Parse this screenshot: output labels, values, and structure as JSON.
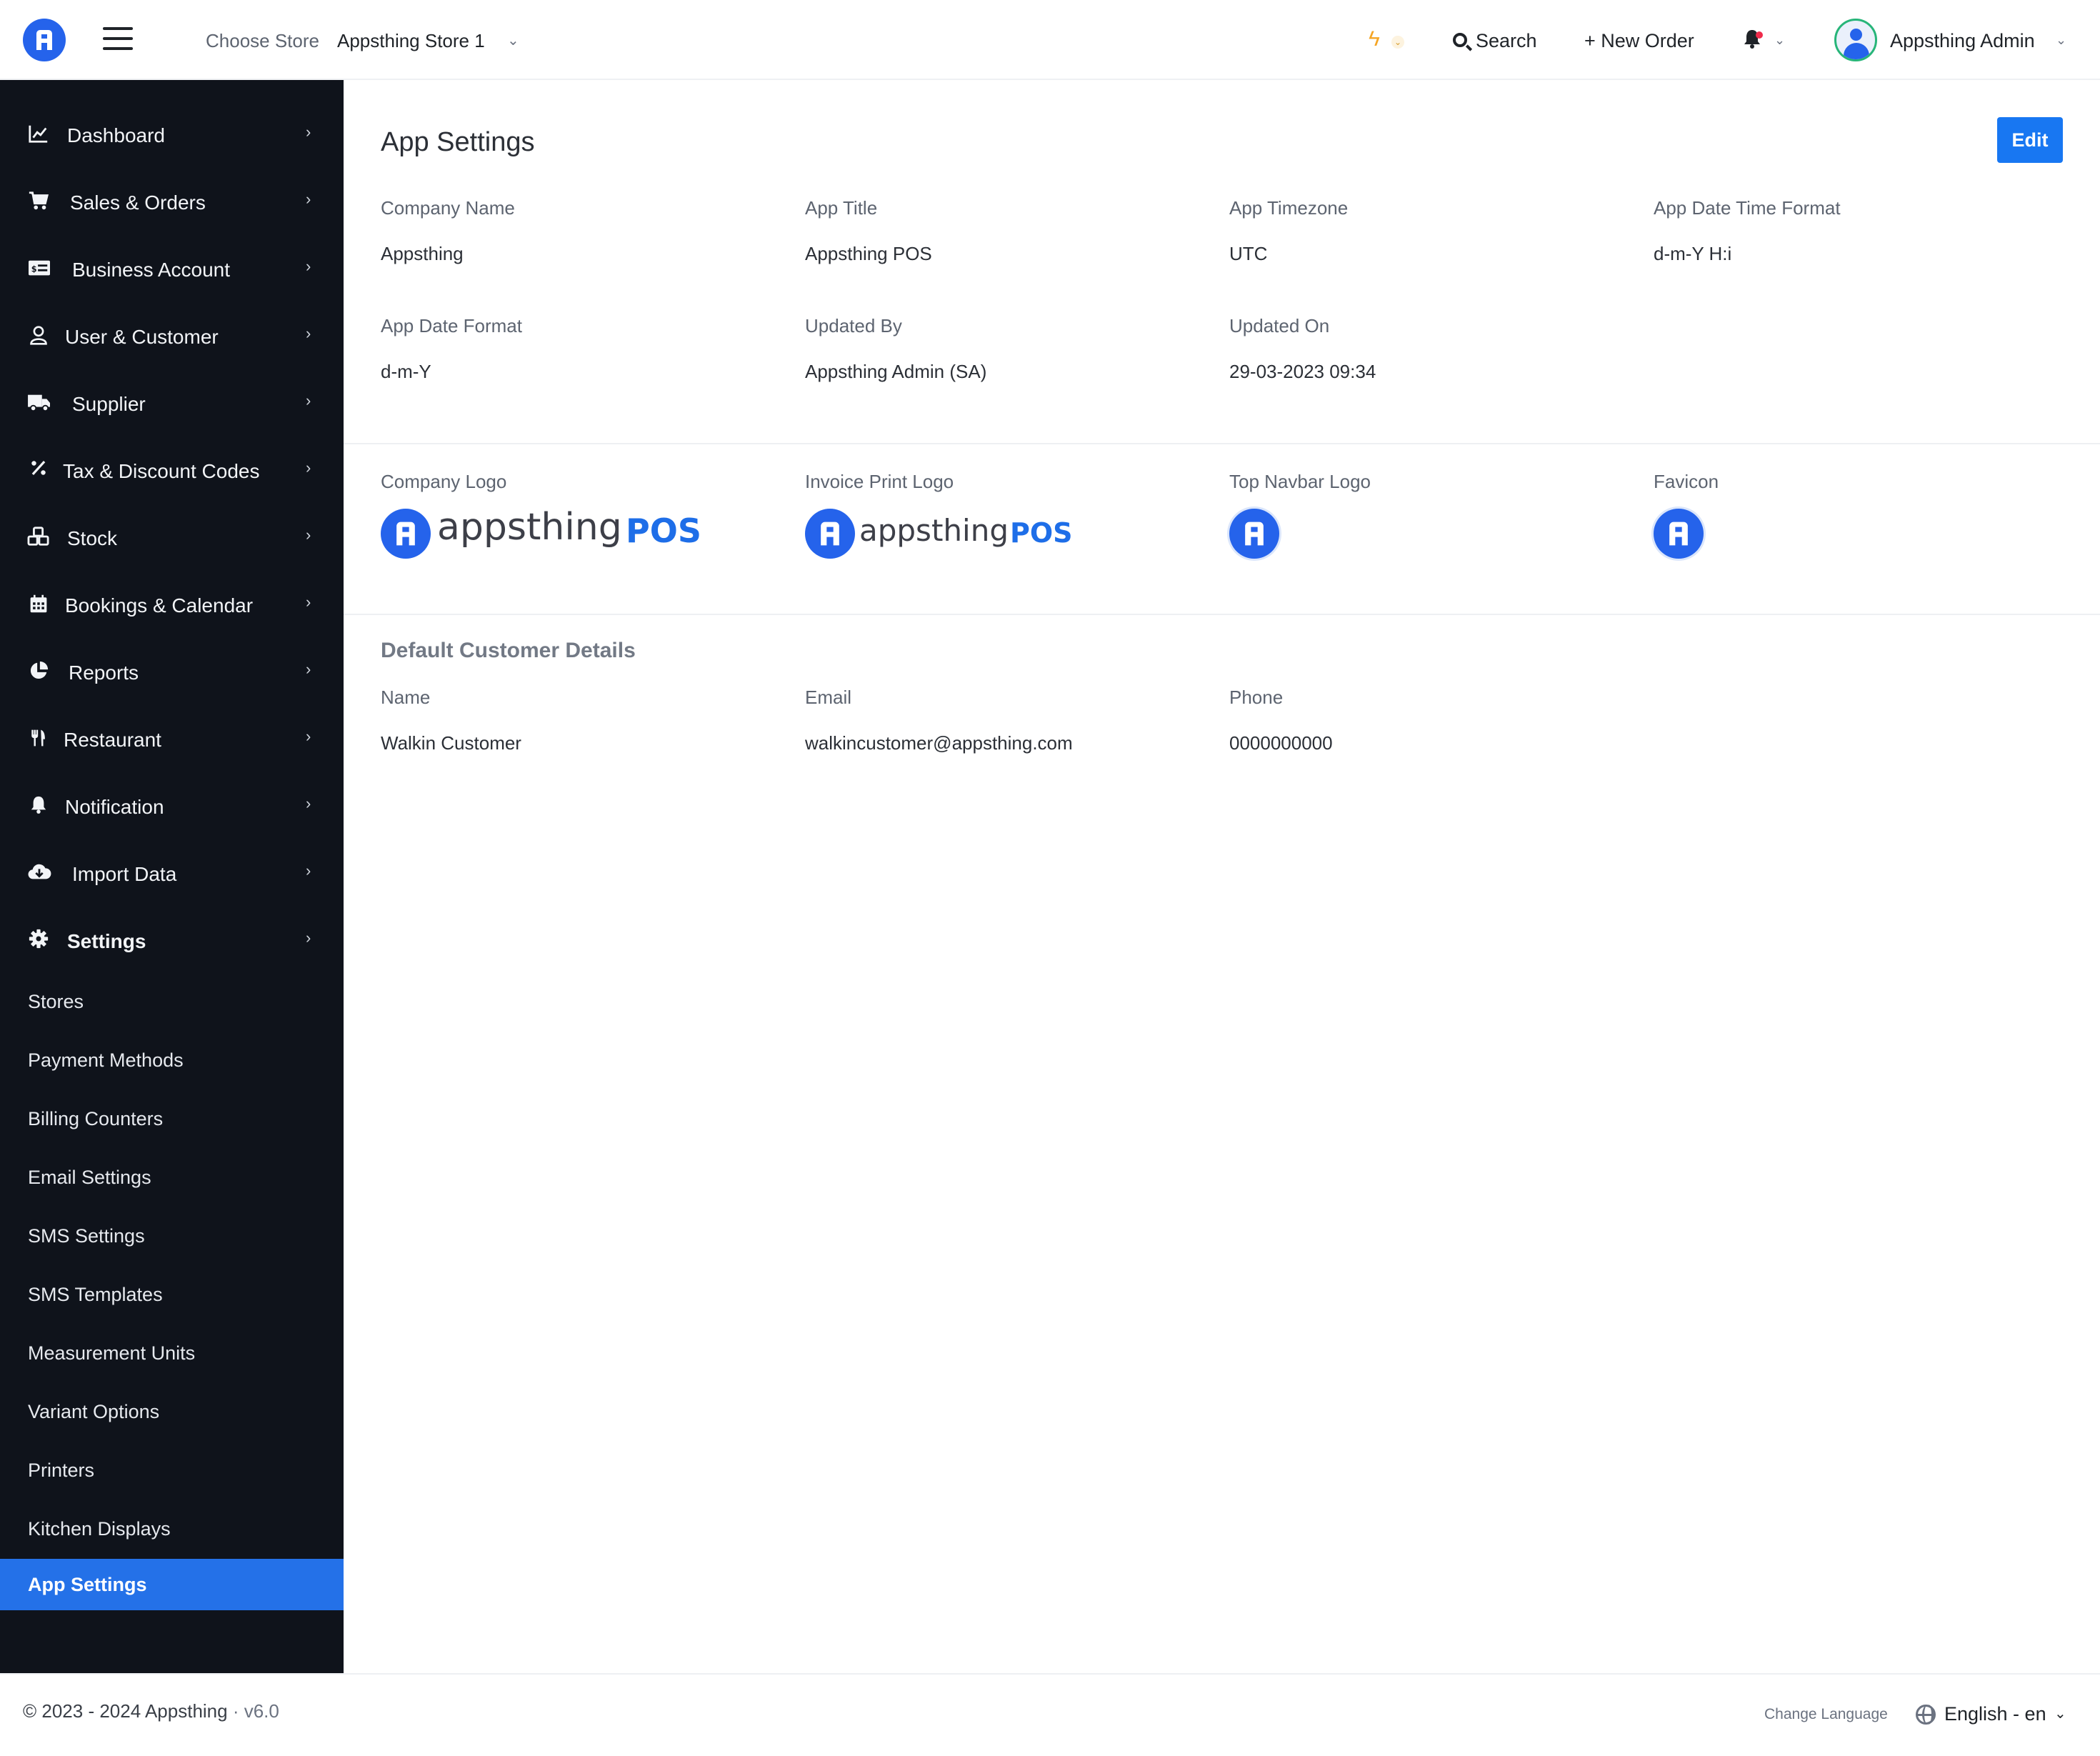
{
  "header": {
    "store_label": "Choose Store",
    "store_value": "Appsthing Store 1",
    "search_label": "Search",
    "new_order_label": "+ New Order",
    "admin_name": "Appsthing Admin"
  },
  "sidebar": {
    "items": [
      {
        "label": "Dashboard",
        "icon": "chart-line-icon"
      },
      {
        "label": "Sales & Orders",
        "icon": "cart-icon"
      },
      {
        "label": "Business Account",
        "icon": "money-card-icon"
      },
      {
        "label": "User & Customer",
        "icon": "user-icon"
      },
      {
        "label": "Supplier",
        "icon": "truck-icon"
      },
      {
        "label": "Tax & Discount Codes",
        "icon": "percent-icon"
      },
      {
        "label": "Stock",
        "icon": "boxes-icon"
      },
      {
        "label": "Bookings & Calendar",
        "icon": "calendar-icon"
      },
      {
        "label": "Reports",
        "icon": "pie-chart-icon"
      },
      {
        "label": "Restaurant",
        "icon": "utensils-icon"
      },
      {
        "label": "Notification",
        "icon": "bell-icon"
      },
      {
        "label": "Import Data",
        "icon": "cloud-download-icon"
      },
      {
        "label": "Settings",
        "icon": "gear-icon"
      }
    ],
    "sub_items": [
      "Stores",
      "Payment Methods",
      "Billing Counters",
      "Email Settings",
      "SMS Settings",
      "SMS Templates",
      "Measurement Units",
      "Variant Options",
      "Printers",
      "Kitchen Displays",
      "App Settings"
    ],
    "active_sub_item": "App Settings"
  },
  "main": {
    "title": "App Settings",
    "edit_label": "Edit",
    "fields": [
      {
        "label": "Company Name",
        "value": "Appsthing"
      },
      {
        "label": "App Title",
        "value": "Appsthing POS"
      },
      {
        "label": "App Timezone",
        "value": "UTC"
      },
      {
        "label": "App Date Time Format",
        "value": "d-m-Y H:i"
      },
      {
        "label": "App Date Format",
        "value": "d-m-Y"
      },
      {
        "label": "Updated By",
        "value": "Appsthing Admin (SA)"
      },
      {
        "label": "Updated On",
        "value": "29-03-2023 09:34"
      }
    ],
    "logos": {
      "company_logo_label": "Company Logo",
      "invoice_logo_label": "Invoice Print Logo",
      "navbar_logo_label": "Top Navbar Logo",
      "favicon_label": "Favicon",
      "logo_word": "appsthing",
      "logo_suffix": "POS"
    },
    "customer": {
      "title": "Default Customer Details",
      "name_label": "Name",
      "name_value": "Walkin Customer",
      "email_label": "Email",
      "email_value": "walkincustomer@appsthing.com",
      "phone_label": "Phone",
      "phone_value": "0000000000"
    }
  },
  "footer": {
    "copyright": "© 2023 - 2024 Appsthing",
    "version": "· v6.0",
    "change_language": "Change Language",
    "language_value": "English - en"
  },
  "colors": {
    "brand_blue": "#2563eb",
    "button_blue": "#1877f2",
    "sidebar_bg": "#0f131b",
    "active_item_bg": "#2471e8",
    "notification_dot": "#ef2b4b",
    "bolt_yellow": "#f5a524"
  }
}
